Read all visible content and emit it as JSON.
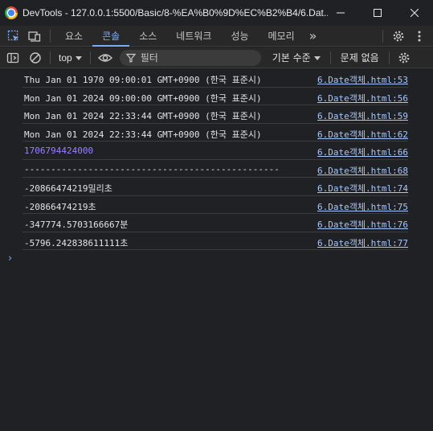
{
  "window": {
    "title": "DevTools - 127.0.0.1:5500/Basic/8-%EA%B0%9D%EC%B2%B4/6.Dat...",
    "buttons": [
      "minimize",
      "maximize",
      "close"
    ]
  },
  "tabs": [
    {
      "label": "요소",
      "active": false
    },
    {
      "label": "콘솔",
      "active": true
    },
    {
      "label": "소스",
      "active": false
    },
    {
      "label": "네트워크",
      "active": false
    },
    {
      "label": "성능",
      "active": false
    },
    {
      "label": "메모리",
      "active": false
    }
  ],
  "tabbar": {
    "more": "»"
  },
  "toolbar": {
    "context": "top",
    "filter_placeholder": "필터",
    "levels": "기본 수준",
    "issues": "문제 없음"
  },
  "console": {
    "rows": [
      {
        "text": "Thu Jan 01 1970 09:00:01 GMT+0900 (한국 표준시)",
        "source": "6.Date객체.html:53",
        "type": "string"
      },
      {
        "text": "Mon Jan 01 2024 09:00:00 GMT+0900 (한국 표준시)",
        "source": "6.Date객체.html:56",
        "type": "string"
      },
      {
        "text": "Mon Jan 01 2024 22:33:44 GMT+0900 (한국 표준시)",
        "source": "6.Date객체.html:59",
        "type": "string"
      },
      {
        "text": "Mon Jan 01 2024 22:33:44 GMT+0900 (한국 표준시)",
        "source": "6.Date객체.html:62",
        "type": "string"
      },
      {
        "text": "1706794424000",
        "source": "6.Date객체.html:66",
        "type": "number"
      },
      {
        "text": "------------------------------------------------",
        "source": "6.Date객체.html:68",
        "type": "string"
      },
      {
        "text": "-20866474219밀리초",
        "source": "6.Date객체.html:74",
        "type": "string"
      },
      {
        "text": "-20866474219초",
        "source": "6.Date객체.html:75",
        "type": "string"
      },
      {
        "text": "-347774.5703166667분",
        "source": "6.Date객체.html:76",
        "type": "string"
      },
      {
        "text": "-5796.242838611111초",
        "source": "6.Date객체.html:77",
        "type": "string"
      }
    ],
    "prompt": "›"
  }
}
